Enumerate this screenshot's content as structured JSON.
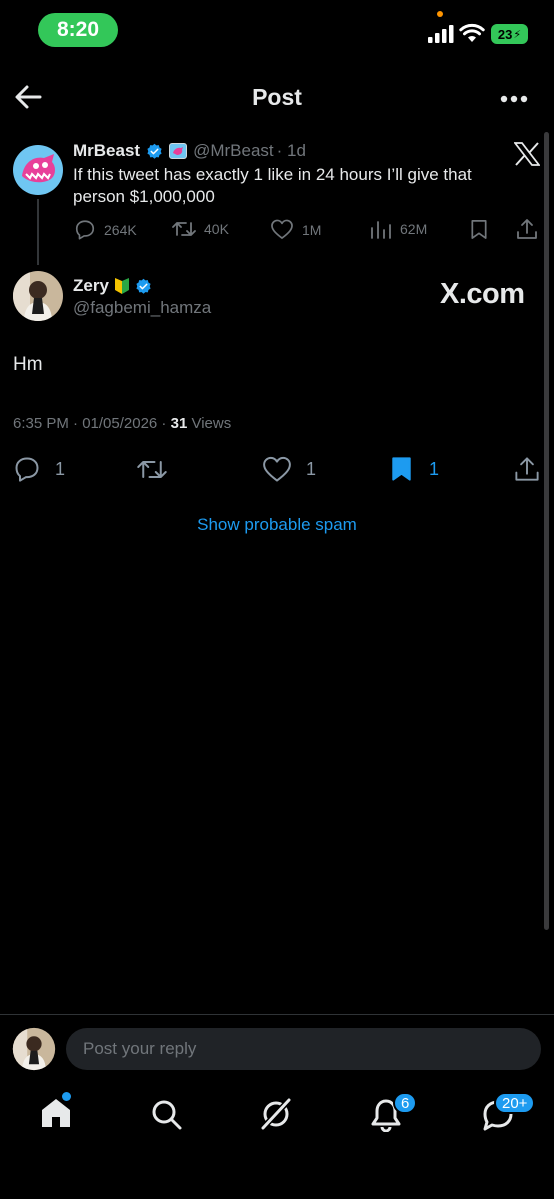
{
  "status_bar": {
    "time": "8:20",
    "battery": "23"
  },
  "header": {
    "title": "Post"
  },
  "quoted_tweet": {
    "name": "MrBeast",
    "handle": "@MrBeast",
    "time": "· 1d",
    "text_line1": "If this tweet has exactly 1 like in 24 hours I’ll give that",
    "text_line2": "person $1,000,000",
    "stats": {
      "replies": "264K",
      "reposts": "40K",
      "likes": "1M",
      "views": "62M"
    }
  },
  "reply_tweet": {
    "name": "Zery",
    "handle": "@fagbemi_hamza",
    "watermark": "X.com",
    "text": "Hm",
    "timestamp": "6:35 PM · 01/05/2026 · ",
    "views_count": "31",
    "views_label": " Views",
    "actions": {
      "replies": "1",
      "likes": "1",
      "bookmarks": "1"
    }
  },
  "spam_link": "Show probable spam",
  "reply_bar": {
    "placeholder": "Post your reply"
  },
  "bottom_nav": {
    "notifications_badge": "6",
    "messages_badge": "20+"
  },
  "colors": {
    "accent": "#1d9bf0",
    "background": "#000000",
    "muted": "#71767b",
    "status_green": "#33c759"
  }
}
